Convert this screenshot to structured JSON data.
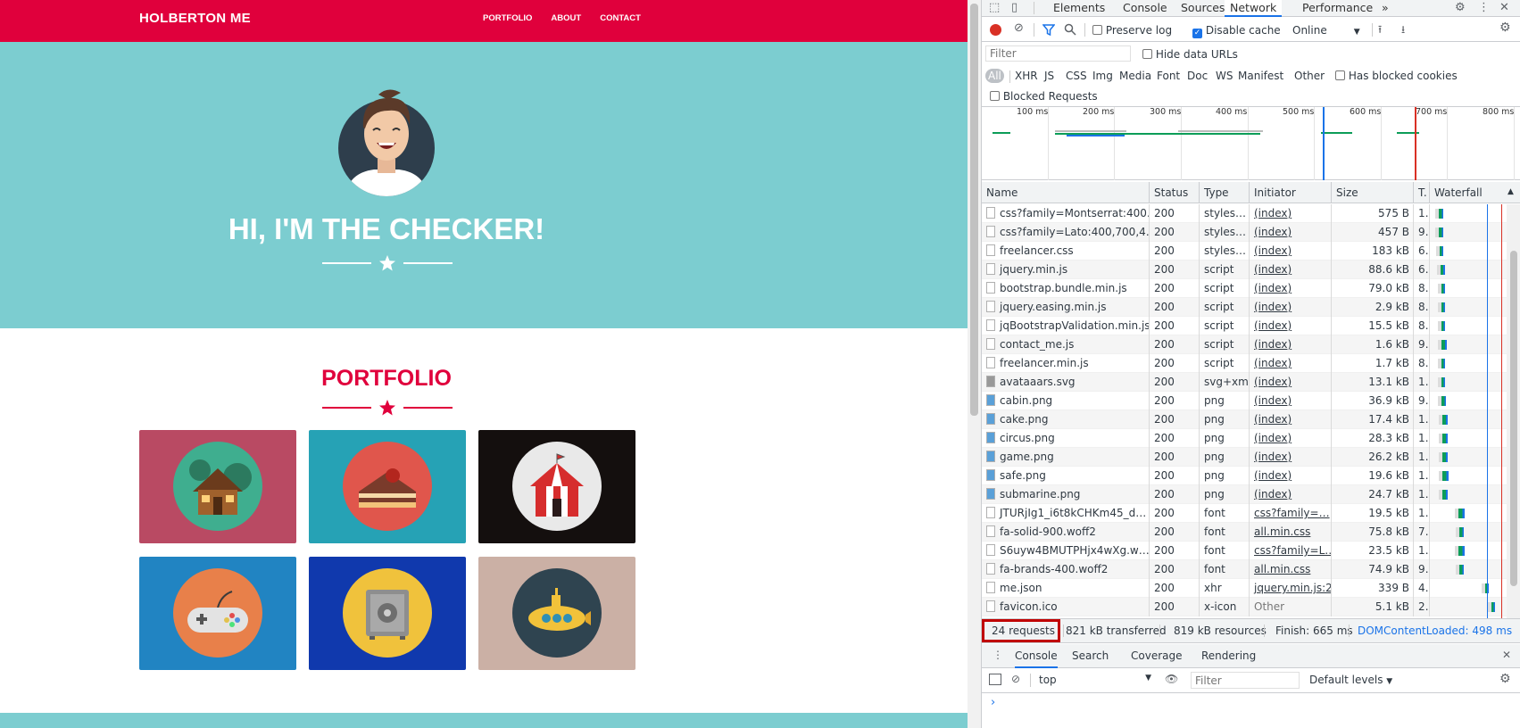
{
  "site": {
    "brand": "HOLBERTON ME",
    "nav": [
      "PORTFOLIO",
      "ABOUT",
      "CONTACT"
    ],
    "hero_title": "HI, I'M THE CHECKER!",
    "portfolio_title": "PORTFOLIO",
    "tiles": [
      {
        "name": "cabin",
        "bg": "#b94a63",
        "circle": "#3fae8f"
      },
      {
        "name": "cake",
        "bg": "#26a2b5",
        "circle": "#e0564c"
      },
      {
        "name": "circus",
        "bg": "#140f0e",
        "circle": "#e9e9e9"
      },
      {
        "name": "game",
        "bg": "#2184c2",
        "circle": "#e8804a"
      },
      {
        "name": "safe",
        "bg": "#1039ad",
        "circle": "#f0c23c"
      },
      {
        "name": "submarine",
        "bg": "#cbb0a5",
        "circle": "#2f4450"
      }
    ],
    "colors": {
      "accent": "#e0003c",
      "hero": "#7ccdd0"
    }
  },
  "devtools": {
    "tabs": [
      "Elements",
      "Console",
      "Sources",
      "Network",
      "Performance"
    ],
    "active_tab": "Network",
    "more_tabs": "»",
    "toolbar": {
      "preserve_log": "Preserve log",
      "disable_cache": "Disable cache",
      "throttle": "Online"
    },
    "filter": {
      "placeholder": "Filter",
      "hide_data_urls": "Hide data URLs",
      "types": [
        "All",
        "XHR",
        "JS",
        "CSS",
        "Img",
        "Media",
        "Font",
        "Doc",
        "WS",
        "Manifest",
        "Other"
      ],
      "has_blocked_cookies": "Has blocked cookies",
      "blocked_requests": "Blocked Requests"
    },
    "overview_ticks": [
      "100 ms",
      "200 ms",
      "300 ms",
      "400 ms",
      "500 ms",
      "600 ms",
      "700 ms",
      "800 ms"
    ],
    "columns": {
      "name": "Name",
      "status": "Status",
      "type": "Type",
      "initiator": "Initiator",
      "size": "Size",
      "time": "T.",
      "waterfall": "Waterfall"
    },
    "rows": [
      {
        "name": "css?family=Montserrat:400…",
        "status": "200",
        "type": "styles…",
        "initiator": "(index)",
        "size": "575 B",
        "time": "1…",
        "icon": "doc",
        "wf": [
          0.12,
          0.18
        ]
      },
      {
        "name": "css?family=Lato:400,700,4…",
        "status": "200",
        "type": "styles…",
        "initiator": "(index)",
        "size": "457 B",
        "time": "9…",
        "icon": "doc",
        "wf": [
          0.12,
          0.18
        ]
      },
      {
        "name": "freelancer.css",
        "status": "200",
        "type": "styles…",
        "initiator": "(index)",
        "size": "183 kB",
        "time": "6…",
        "icon": "doc",
        "wf": [
          0.13,
          0.16
        ]
      },
      {
        "name": "jquery.min.js",
        "status": "200",
        "type": "script",
        "initiator": "(index)",
        "size": "88.6 kB",
        "time": "6…",
        "icon": "doc",
        "wf": [
          0.14,
          0.2
        ]
      },
      {
        "name": "bootstrap.bundle.min.js",
        "status": "200",
        "type": "script",
        "initiator": "(index)",
        "size": "79.0 kB",
        "time": "8…",
        "icon": "doc",
        "wf": [
          0.15,
          0.2
        ]
      },
      {
        "name": "jquery.easing.min.js",
        "status": "200",
        "type": "script",
        "initiator": "(index)",
        "size": "2.9 kB",
        "time": "8…",
        "icon": "doc",
        "wf": [
          0.15,
          0.2
        ]
      },
      {
        "name": "jqBootstrapValidation.min.js",
        "status": "200",
        "type": "script",
        "initiator": "(index)",
        "size": "15.5 kB",
        "time": "8…",
        "icon": "doc",
        "wf": [
          0.15,
          0.2
        ]
      },
      {
        "name": "contact_me.js",
        "status": "200",
        "type": "script",
        "initiator": "(index)",
        "size": "1.6 kB",
        "time": "9…",
        "icon": "doc",
        "wf": [
          0.15,
          0.22
        ]
      },
      {
        "name": "freelancer.min.js",
        "status": "200",
        "type": "script",
        "initiator": "(index)",
        "size": "1.7 kB",
        "time": "8…",
        "icon": "doc",
        "wf": [
          0.15,
          0.2
        ]
      },
      {
        "name": "avataaars.svg",
        "status": "200",
        "type": "svg+xml",
        "initiator": "(index)",
        "size": "13.1 kB",
        "time": "1…",
        "icon": "svg",
        "wf": [
          0.15,
          0.2
        ]
      },
      {
        "name": "cabin.png",
        "status": "200",
        "type": "png",
        "initiator": "(index)",
        "size": "36.9 kB",
        "time": "9…",
        "icon": "img",
        "wf": [
          0.15,
          0.21
        ]
      },
      {
        "name": "cake.png",
        "status": "200",
        "type": "png",
        "initiator": "(index)",
        "size": "17.4 kB",
        "time": "1…",
        "icon": "img",
        "wf": [
          0.16,
          0.23
        ]
      },
      {
        "name": "circus.png",
        "status": "200",
        "type": "png",
        "initiator": "(index)",
        "size": "28.3 kB",
        "time": "1…",
        "icon": "img",
        "wf": [
          0.16,
          0.23
        ]
      },
      {
        "name": "game.png",
        "status": "200",
        "type": "png",
        "initiator": "(index)",
        "size": "26.2 kB",
        "time": "1…",
        "icon": "img",
        "wf": [
          0.16,
          0.23
        ]
      },
      {
        "name": "safe.png",
        "status": "200",
        "type": "png",
        "initiator": "(index)",
        "size": "19.6 kB",
        "time": "1…",
        "icon": "img",
        "wf": [
          0.16,
          0.24
        ]
      },
      {
        "name": "submarine.png",
        "status": "200",
        "type": "png",
        "initiator": "(index)",
        "size": "24.7 kB",
        "time": "1…",
        "icon": "img",
        "wf": [
          0.16,
          0.23
        ]
      },
      {
        "name": "JTURjIg1_i6t8kCHKm45_d…",
        "status": "200",
        "type": "font",
        "initiator": "css?family=…",
        "size": "19.5 kB",
        "time": "1…",
        "icon": "doc",
        "wf": [
          0.37,
          0.45
        ]
      },
      {
        "name": "fa-solid-900.woff2",
        "status": "200",
        "type": "font",
        "initiator": "all.min.css",
        "size": "75.8 kB",
        "time": "7…",
        "icon": "doc",
        "wf": [
          0.38,
          0.44
        ]
      },
      {
        "name": "S6uyw4BMUTPHjx4wXg.w…",
        "status": "200",
        "type": "font",
        "initiator": "css?family=L…",
        "size": "23.5 kB",
        "time": "1…",
        "icon": "doc",
        "wf": [
          0.37,
          0.45
        ]
      },
      {
        "name": "fa-brands-400.woff2",
        "status": "200",
        "type": "font",
        "initiator": "all.min.css",
        "size": "74.9 kB",
        "time": "9…",
        "icon": "doc",
        "wf": [
          0.38,
          0.44
        ]
      },
      {
        "name": "me.json",
        "status": "200",
        "type": "xhr",
        "initiator": "jquery.min.js:2",
        "size": "339 B",
        "time": "4…",
        "icon": "doc",
        "wf": [
          0.72,
          0.76
        ]
      },
      {
        "name": "favicon.ico",
        "status": "200",
        "type": "x-icon",
        "initiator": "Other",
        "size": "5.1 kB",
        "time": "2…",
        "icon": "doc",
        "wf": [
          0.8,
          0.84
        ]
      }
    ],
    "status": {
      "requests": "24 requests",
      "transferred": "821 kB transferred",
      "resources": "819 kB resources",
      "finish": "Finish: 665 ms",
      "dcl": "DOMContentLoaded: 498 ms"
    },
    "drawer": {
      "tabs": [
        "Console",
        "Search",
        "Coverage",
        "Rendering"
      ],
      "context": "top",
      "filter_placeholder": "Filter",
      "levels": "Default levels",
      "prompt": "›"
    }
  }
}
